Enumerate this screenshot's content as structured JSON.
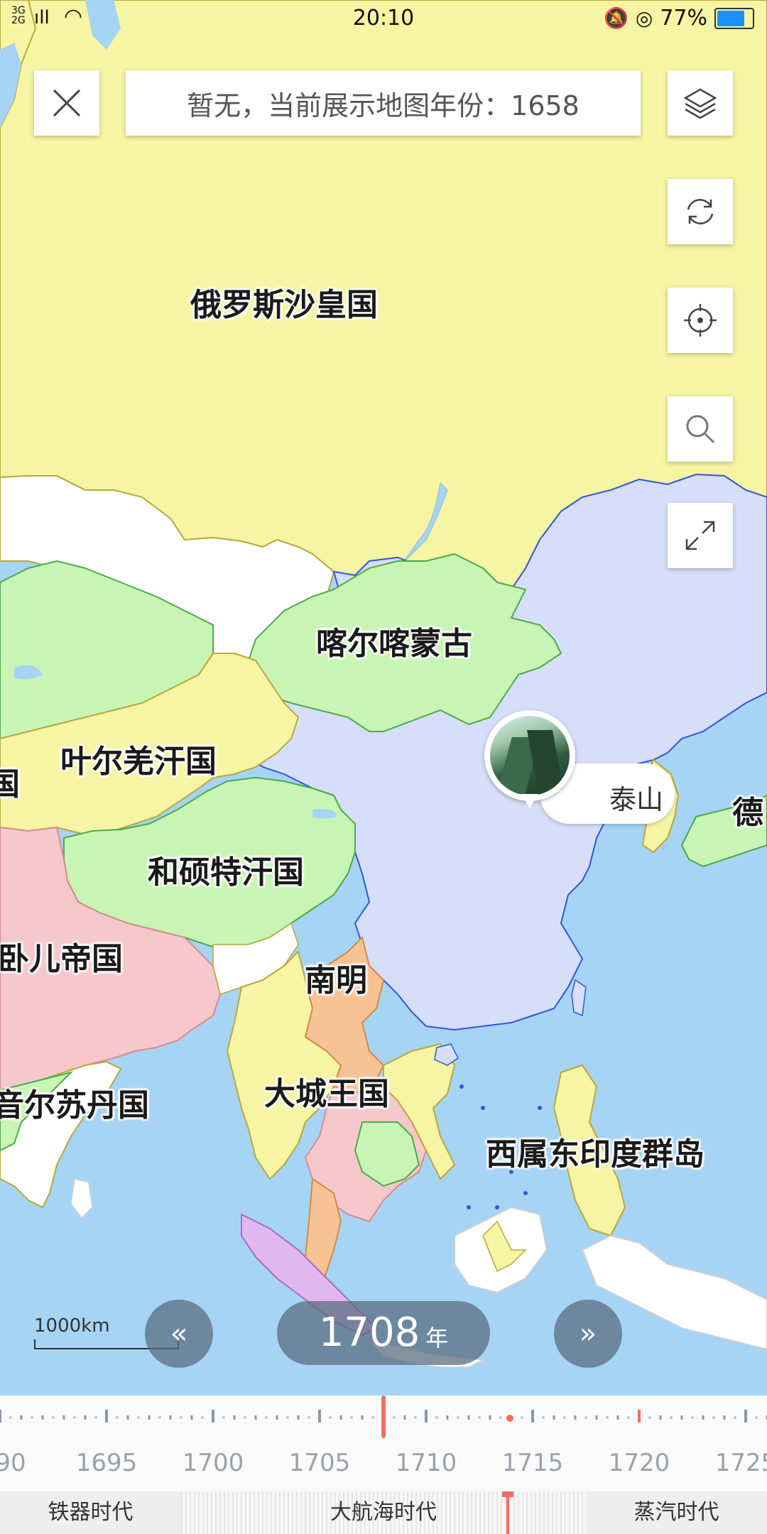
{
  "status_bar": {
    "time": "20:10",
    "network_line1": "3G",
    "network_line2": "2G",
    "battery": "77%"
  },
  "top": {
    "close_icon": "close-icon",
    "search_text": "暂无，当前展示地图年份：1658"
  },
  "side_buttons": [
    "layers-icon",
    "refresh-icon",
    "locate-icon",
    "search-icon",
    "fullscreen-icon"
  ],
  "map": {
    "labels": [
      {
        "id": "russia",
        "text": "俄罗斯沙皇国"
      },
      {
        "id": "khalkha",
        "text": "喀尔喀蒙古"
      },
      {
        "id": "yarkent",
        "text": "叶尔羌汗国"
      },
      {
        "id": "khoshut",
        "text": "和硕特汗国"
      },
      {
        "id": "mughal",
        "text": "卧儿帝国"
      },
      {
        "id": "southern_ming",
        "text": "南明"
      },
      {
        "id": "ayutthaya",
        "text": "大城王国"
      },
      {
        "id": "dutch_indies",
        "text": "西属东印度群岛"
      },
      {
        "id": "golconda",
        "text": "音尔苏丹国"
      },
      {
        "id": "japan_partial",
        "text": "德"
      },
      {
        "id": "partial_left",
        "text": "国"
      }
    ],
    "poi": {
      "name": "泰山",
      "icon": "mountain-photo"
    }
  },
  "scale": {
    "text": "1000km"
  },
  "controls": {
    "prev_icon": "double-chevron-left-icon",
    "next_icon": "double-chevron-right-icon",
    "year": "1708",
    "year_unit": "年"
  },
  "timeline": {
    "labels": [
      "90",
      "1695",
      "1700",
      "1705",
      "1710",
      "1715",
      "1720",
      "1725"
    ],
    "current_year": 1708,
    "marker_year": 1714
  },
  "eras": [
    "铁器时代",
    "大航海时代",
    "蒸汽时代"
  ],
  "colors": {
    "ocean": "#a6d4f5",
    "russia": "#f5f5a3",
    "qing": "#d6defa",
    "mongol_green": "#c8f5b4",
    "mughal_pink": "#f6c8cc",
    "ming_orange": "#f8c394",
    "accent_red": "#f26e5a"
  }
}
